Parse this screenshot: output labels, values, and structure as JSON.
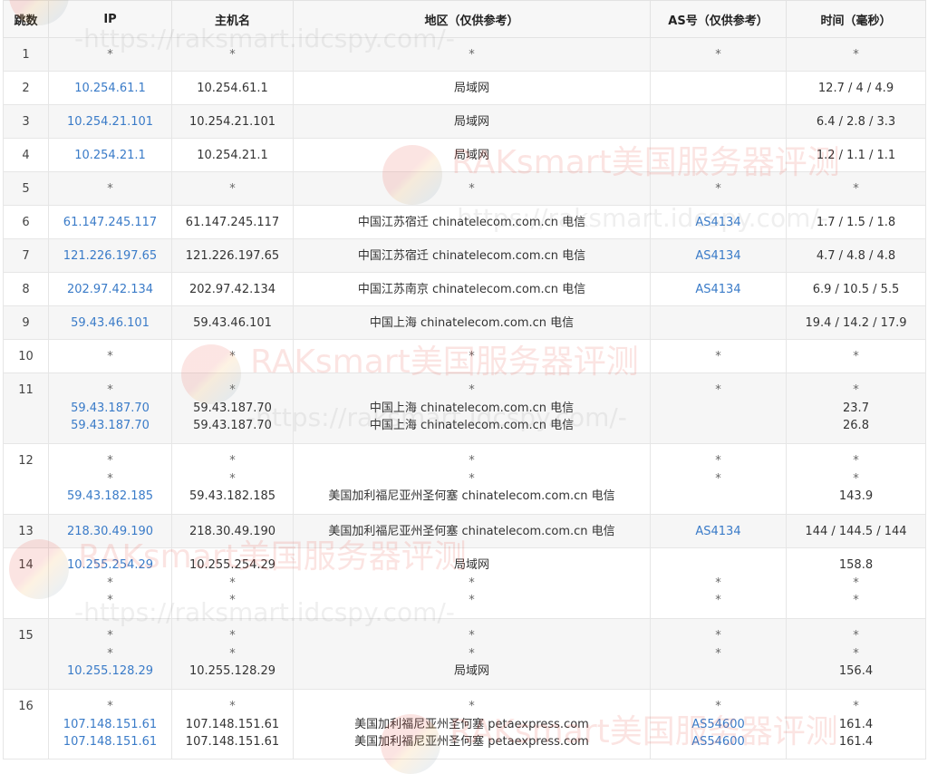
{
  "headers": [
    "跳数",
    "IP",
    "主机名",
    "地区（仅供参考）",
    "AS号（仅供参考）",
    "时间（毫秒）"
  ],
  "watermark": {
    "text": "RAKsmart美国服务器评测",
    "url": "-https://raksmart.idcspy.com/-"
  },
  "colors": {
    "link": "#3a7bc8",
    "header_bg": "#f7f7f7",
    "stripe": "#f6f6f6"
  },
  "rows": [
    {
      "hop": "1",
      "ip": [
        "*"
      ],
      "host": [
        "*"
      ],
      "region": [
        "*"
      ],
      "asn": [
        "*"
      ],
      "time": [
        "*"
      ]
    },
    {
      "hop": "2",
      "ip": [
        "10.254.61.1"
      ],
      "host": [
        "10.254.61.1"
      ],
      "region": [
        "局域网"
      ],
      "asn": [
        ""
      ],
      "time": [
        "12.7 / 4 / 4.9"
      ]
    },
    {
      "hop": "3",
      "ip": [
        "10.254.21.101"
      ],
      "host": [
        "10.254.21.101"
      ],
      "region": [
        "局域网"
      ],
      "asn": [
        ""
      ],
      "time": [
        "6.4 / 2.8 / 3.3"
      ]
    },
    {
      "hop": "4",
      "ip": [
        "10.254.21.1"
      ],
      "host": [
        "10.254.21.1"
      ],
      "region": [
        "局域网"
      ],
      "asn": [
        ""
      ],
      "time": [
        "1.2 / 1.1 / 1.1"
      ]
    },
    {
      "hop": "5",
      "ip": [
        "*"
      ],
      "host": [
        "*"
      ],
      "region": [
        "*"
      ],
      "asn": [
        "*"
      ],
      "time": [
        "*"
      ]
    },
    {
      "hop": "6",
      "ip": [
        "61.147.245.117"
      ],
      "host": [
        "61.147.245.117"
      ],
      "region": [
        "中国江苏宿迁 chinatelecom.com.cn 电信"
      ],
      "asn": [
        "AS4134"
      ],
      "time": [
        "1.7 / 1.5 / 1.8"
      ]
    },
    {
      "hop": "7",
      "ip": [
        "121.226.197.65"
      ],
      "host": [
        "121.226.197.65"
      ],
      "region": [
        "中国江苏宿迁 chinatelecom.com.cn 电信"
      ],
      "asn": [
        "AS4134"
      ],
      "time": [
        "4.7 / 4.8 / 4.8"
      ]
    },
    {
      "hop": "8",
      "ip": [
        "202.97.42.134"
      ],
      "host": [
        "202.97.42.134"
      ],
      "region": [
        "中国江苏南京 chinatelecom.com.cn 电信"
      ],
      "asn": [
        "AS4134"
      ],
      "time": [
        "6.9 / 10.5 / 5.5"
      ]
    },
    {
      "hop": "9",
      "ip": [
        "59.43.46.101"
      ],
      "host": [
        "59.43.46.101"
      ],
      "region": [
        "中国上海 chinatelecom.com.cn 电信"
      ],
      "asn": [
        ""
      ],
      "time": [
        "19.4 / 14.2 / 17.9"
      ]
    },
    {
      "hop": "10",
      "ip": [
        "*"
      ],
      "host": [
        "*"
      ],
      "region": [
        "*"
      ],
      "asn": [
        "*"
      ],
      "time": [
        "*"
      ]
    },
    {
      "hop": "11",
      "ip": [
        "*",
        "59.43.187.70",
        "59.43.187.70"
      ],
      "host": [
        "*",
        "59.43.187.70",
        "59.43.187.70"
      ],
      "region": [
        "*",
        "中国上海 chinatelecom.com.cn 电信",
        "中国上海 chinatelecom.com.cn 电信"
      ],
      "asn": [
        "*",
        "",
        ""
      ],
      "time": [
        "*",
        "23.7",
        "26.8"
      ]
    },
    {
      "hop": "12",
      "ip": [
        "*",
        "*",
        "59.43.182.185"
      ],
      "host": [
        "*",
        "*",
        "59.43.182.185"
      ],
      "region": [
        "*",
        "*",
        "美国加利福尼亚州圣何塞 chinatelecom.com.cn 电信"
      ],
      "asn": [
        "*",
        "*",
        ""
      ],
      "time": [
        "*",
        "*",
        "143.9"
      ]
    },
    {
      "hop": "13",
      "ip": [
        "218.30.49.190"
      ],
      "host": [
        "218.30.49.190"
      ],
      "region": [
        "美国加利福尼亚州圣何塞 chinatelecom.com.cn 电信"
      ],
      "asn": [
        "AS4134"
      ],
      "time": [
        "144 / 144.5 / 144"
      ]
    },
    {
      "hop": "14",
      "ip": [
        "10.255.254.29",
        "*",
        "*"
      ],
      "host": [
        "10.255.254.29",
        "*",
        "*"
      ],
      "region": [
        "局域网",
        "*",
        "*"
      ],
      "asn": [
        "",
        "*",
        "*"
      ],
      "time": [
        "158.8",
        "*",
        "*"
      ]
    },
    {
      "hop": "15",
      "ip": [
        "*",
        "*",
        "10.255.128.29"
      ],
      "host": [
        "*",
        "*",
        "10.255.128.29"
      ],
      "region": [
        "*",
        "*",
        "局域网"
      ],
      "asn": [
        "*",
        "*",
        ""
      ],
      "time": [
        "*",
        "*",
        "156.4"
      ]
    },
    {
      "hop": "16",
      "ip": [
        "*",
        "107.148.151.61",
        "107.148.151.61"
      ],
      "host": [
        "*",
        "107.148.151.61",
        "107.148.151.61"
      ],
      "region": [
        "*",
        "美国加利福尼亚州圣何塞 petaexpress.com",
        "美国加利福尼亚州圣何塞 petaexpress.com"
      ],
      "asn": [
        "*",
        "AS54600",
        "AS54600"
      ],
      "time": [
        "*",
        "161.4",
        "161.4"
      ]
    }
  ]
}
